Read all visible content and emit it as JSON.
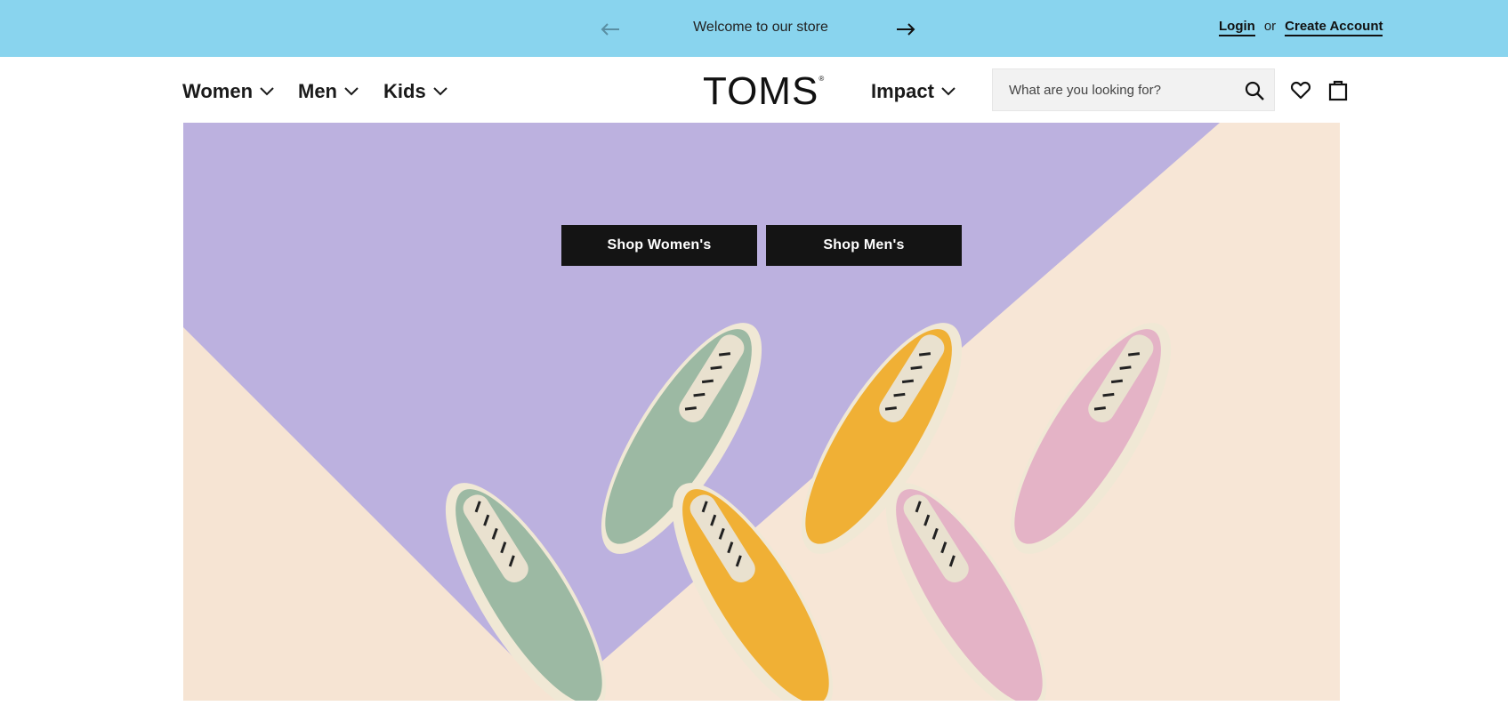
{
  "announcement": {
    "message": "Welcome to our store",
    "prev_icon": "arrow-left-icon",
    "next_icon": "arrow-right-icon"
  },
  "account": {
    "login": "Login",
    "or": "or",
    "create": "Create Account"
  },
  "nav": {
    "women": "Women",
    "men": "Men",
    "kids": "Kids",
    "impact": "Impact"
  },
  "brand": {
    "logo": "TOMS",
    "mark": "®"
  },
  "search": {
    "placeholder": "What are you looking for?",
    "icon": "search-icon"
  },
  "header_icons": {
    "wishlist": "heart-icon",
    "bag": "shopping-bag-icon"
  },
  "hero": {
    "shop_women": "Shop Women's",
    "shop_men": "Shop Men's",
    "image": "six slip-on canvas shoes in sage green, marigold yellow and pink on lavender and cream background"
  },
  "colors": {
    "announce_bg": "#89d4ee",
    "cta_bg": "#141414",
    "hero_lavender": "#bcb1df",
    "hero_cream": "#f7e6d6",
    "shoe_green": "#9cb9a3",
    "shoe_yellow": "#f0b035",
    "shoe_pink": "#e4b3c6"
  }
}
